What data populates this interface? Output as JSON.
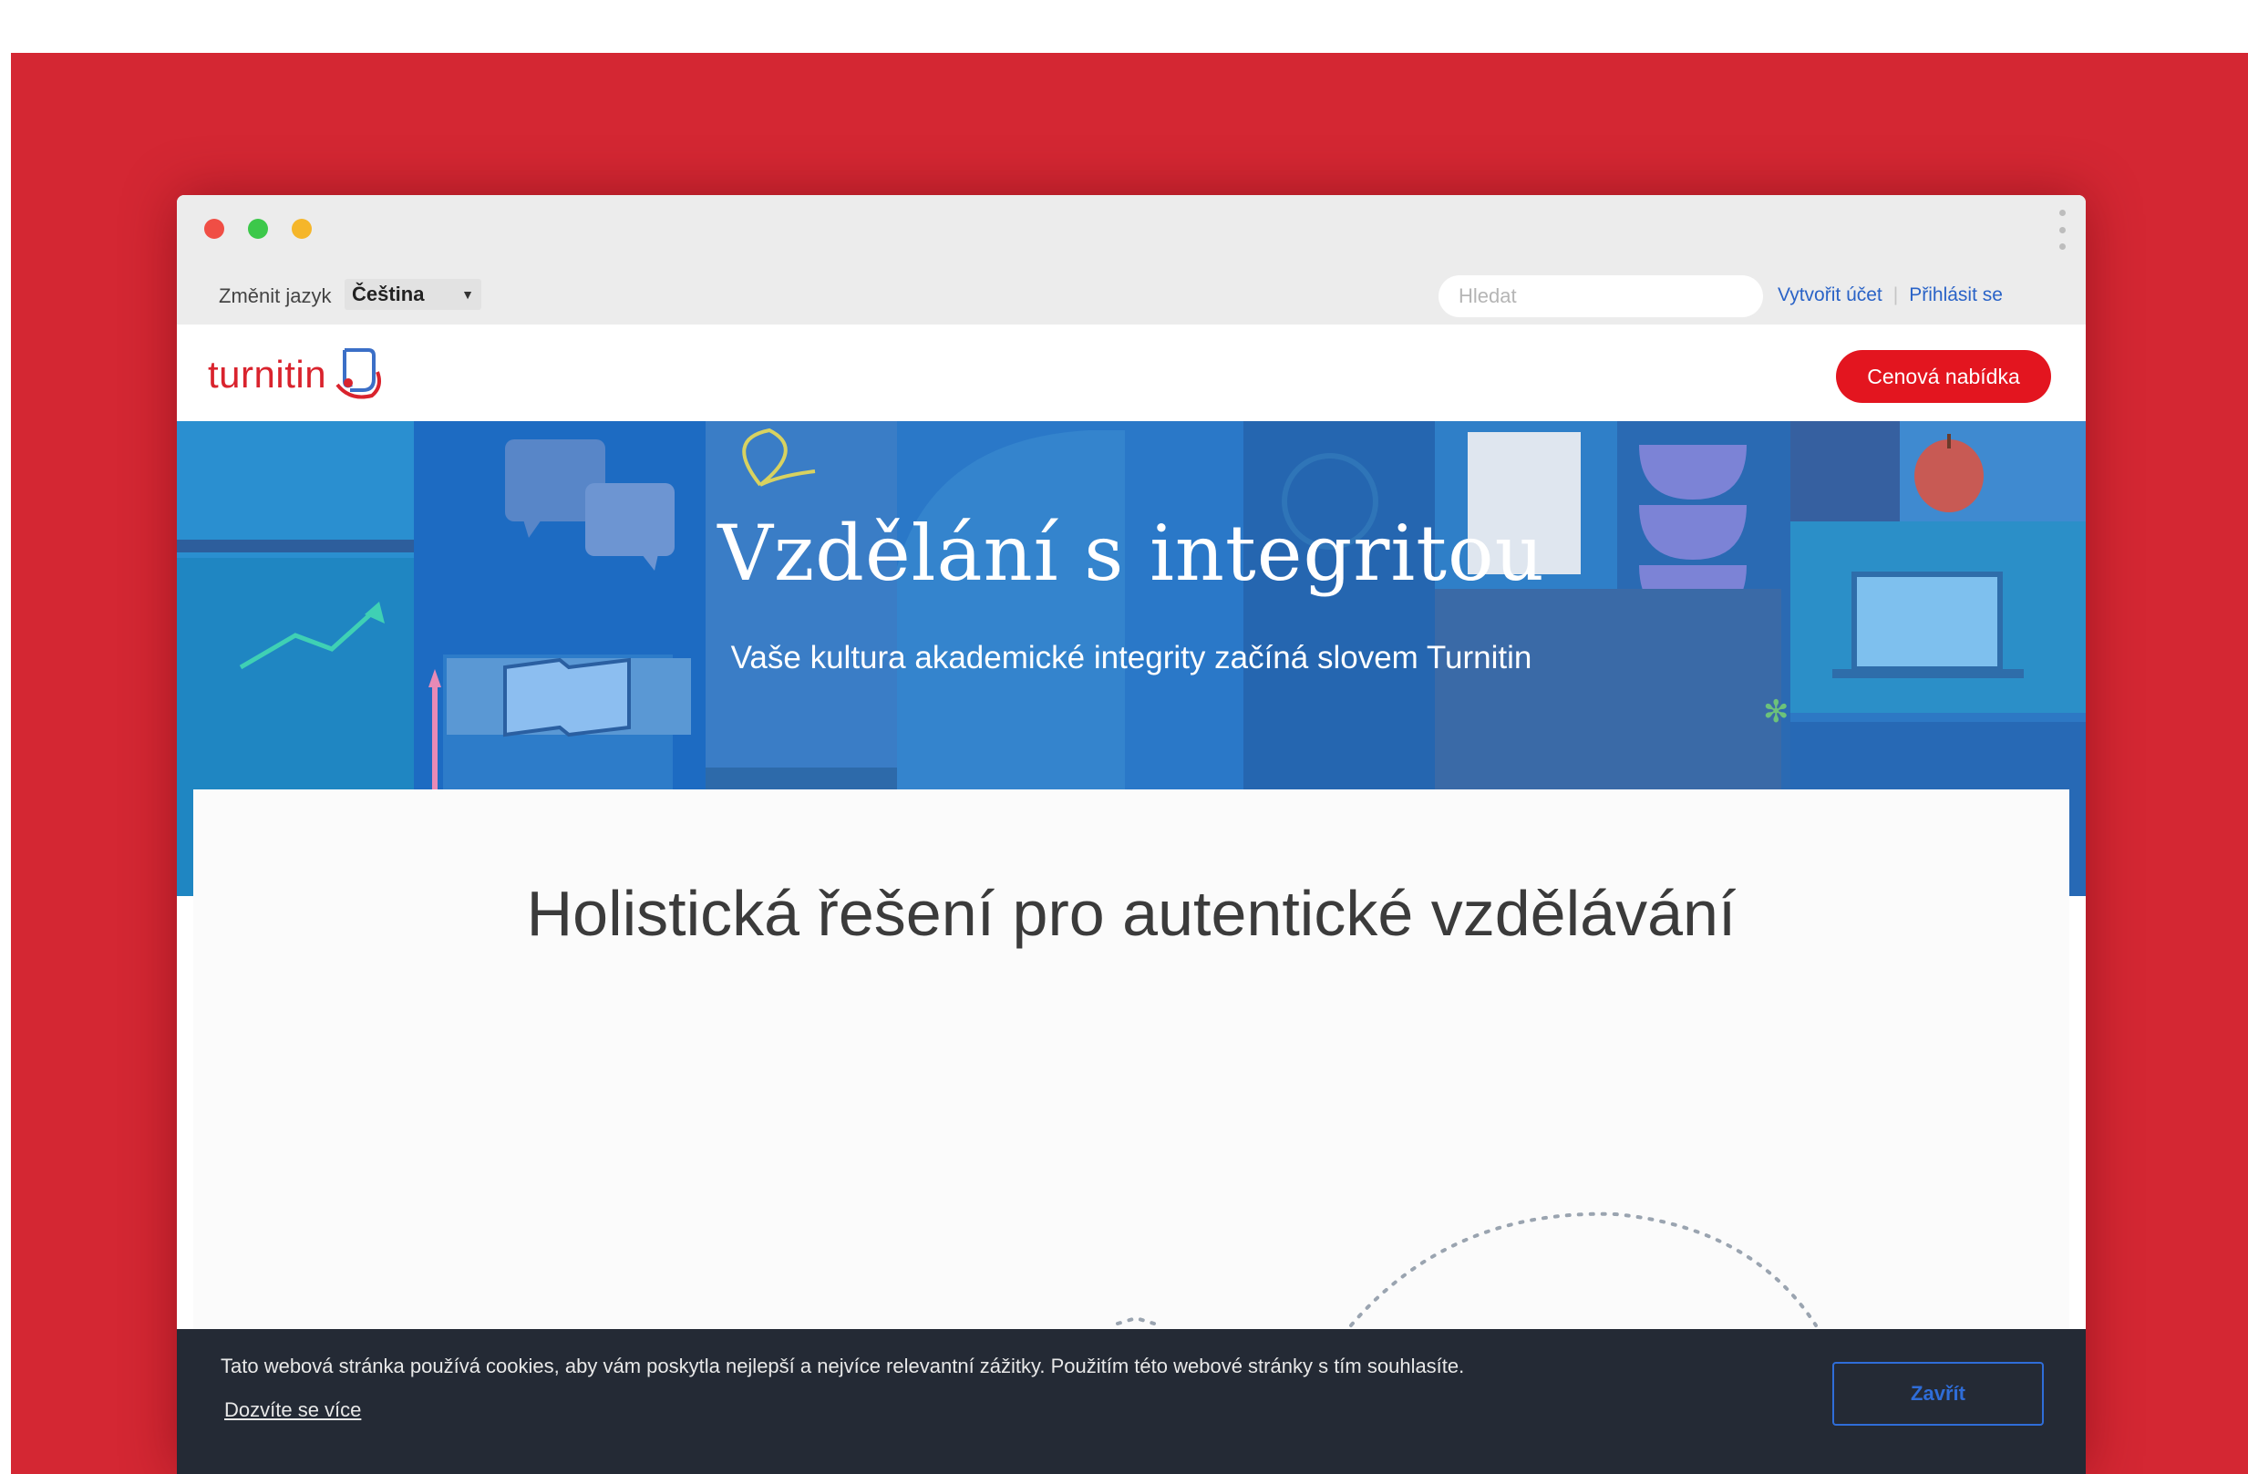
{
  "browser": {
    "traffic_lights": [
      "close-icon",
      "maximize-icon",
      "minimize-icon"
    ],
    "menu_icon": "kebab-menu-icon"
  },
  "utility_bar": {
    "language_label": "Změnit jazyk",
    "language_value": "Čeština",
    "search_placeholder": "Hledat",
    "create_account": "Vytvořit účet",
    "sign_in": "Přihlásit se"
  },
  "navbar": {
    "logo_text": "turnitin",
    "quote_button": "Cenová nabídka"
  },
  "hero": {
    "title": "Vzdělání s integritou",
    "subtitle": "Vaše kultura akademické integrity začíná slovem Turnitin"
  },
  "content": {
    "title": "Holistická řešení pro autentické vzdělávání"
  },
  "cookie_bar": {
    "text": "Tato webová stránka používá cookies, aby vám poskytla nejlepší a nejvíce relevantní zážitky. Použitím této webové stránky s tím souhlasíte.",
    "learn_more": "Dozvíte se více",
    "close_button": "Zavřít"
  },
  "colors": {
    "background_red": "#d42733",
    "brand_red": "#e3151f",
    "hero_blue": "#2876c6",
    "cookie_bar": "#242a35",
    "link_blue": "#2a63c7"
  }
}
